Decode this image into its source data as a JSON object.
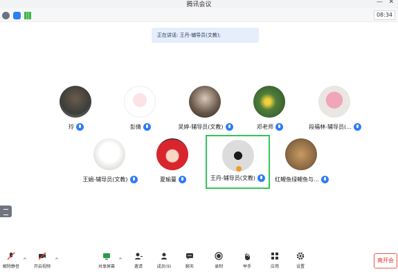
{
  "app": {
    "title": "腾讯会议",
    "minimize": "—",
    "close": "✕"
  },
  "status": {
    "clock": "08:34"
  },
  "speaking": {
    "text": "正在讲话: 王丹-辅导员(文教);"
  },
  "participants": [
    {
      "name": "玲"
    },
    {
      "name": "彭倩"
    },
    {
      "name": "吴婷-辅导员(文教)"
    },
    {
      "name": "邓老师"
    },
    {
      "name": "段福林-辅导员(..."
    },
    {
      "name": "王娟-辅导员(文教)"
    },
    {
      "name": "夏瑜蔓"
    },
    {
      "name": "王丹-辅导员(文教)"
    },
    {
      "name": "红鲤鱼绿鲤鱼与..."
    }
  ],
  "toolbar": {
    "unmute": "解除静音",
    "video": "开启视频",
    "share": "共享屏幕",
    "invite": "邀请",
    "members": "成员(9)",
    "chat": "聊天",
    "record": "录制",
    "raise_hand": "举手",
    "apps": "应用",
    "settings": "设置",
    "leave": "离开会"
  },
  "colors": {
    "accent": "#2f7cf6",
    "active_border": "#32c45a",
    "leave": "#e33333"
  }
}
